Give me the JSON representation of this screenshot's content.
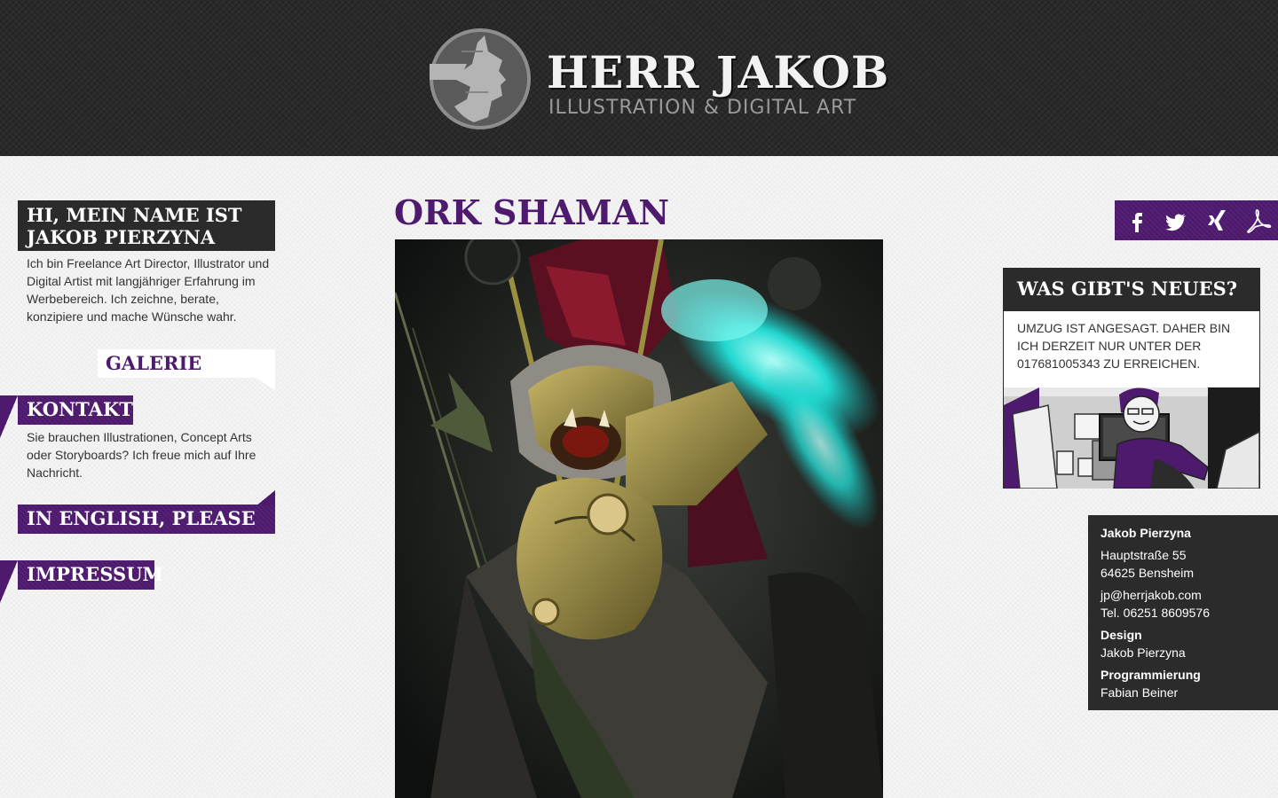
{
  "header": {
    "title": "HERR JAKOB",
    "subtitle": "ILLUSTRATION & DIGITAL ART",
    "logo_icon": "head-silhouette-icon"
  },
  "intro": {
    "title_line1": "HI, MEIN NAME IST",
    "title_line2": "JAKOB PIERZYNA",
    "text": "Ich bin Freelance Art Director, Illustrator und Digital Artist mit langjähriger Erfahrung im Werbebereich. Ich zeichne, berate, konzipiere und mache Wünsche wahr."
  },
  "nav": {
    "galerie": "GALERIE",
    "kontakt": "KONTAKT",
    "kontakt_text": "Sie brauchen Illustrationen, Concept Arts oder Storyboards? Ich freue mich auf Ihre Nachricht.",
    "english": "IN ENGLISH, PLEASE",
    "impressum": "IMPRESSUM"
  },
  "artwork": {
    "title": "ORK SHAMAN"
  },
  "social": {
    "items": [
      "facebook-icon",
      "twitter-icon",
      "xing-icon",
      "pdf-icon"
    ]
  },
  "news": {
    "title": "WAS GIBT'S NEUES?",
    "text": "UMZUG IST ANGESAGT. DAHER BIN ICH DERZEIT NUR UNTER DER 017681005343 ZU ERREICHEN."
  },
  "imprint": {
    "name": "Jakob Pierzyna",
    "street": "Hauptstraße 55",
    "city": "64625 Bensheim",
    "email": "jp@herrjakob.com",
    "phone": "Tel. 06251 8609576",
    "design_label": "Design",
    "design_name": "Jakob Pierzyna",
    "prog_label": "Programmierung",
    "prog_name": "Fabian Beiner"
  },
  "colors": {
    "purple": "#4d1a6e",
    "dark": "#2b2b2b",
    "header_bg": "#2a2a2a"
  }
}
